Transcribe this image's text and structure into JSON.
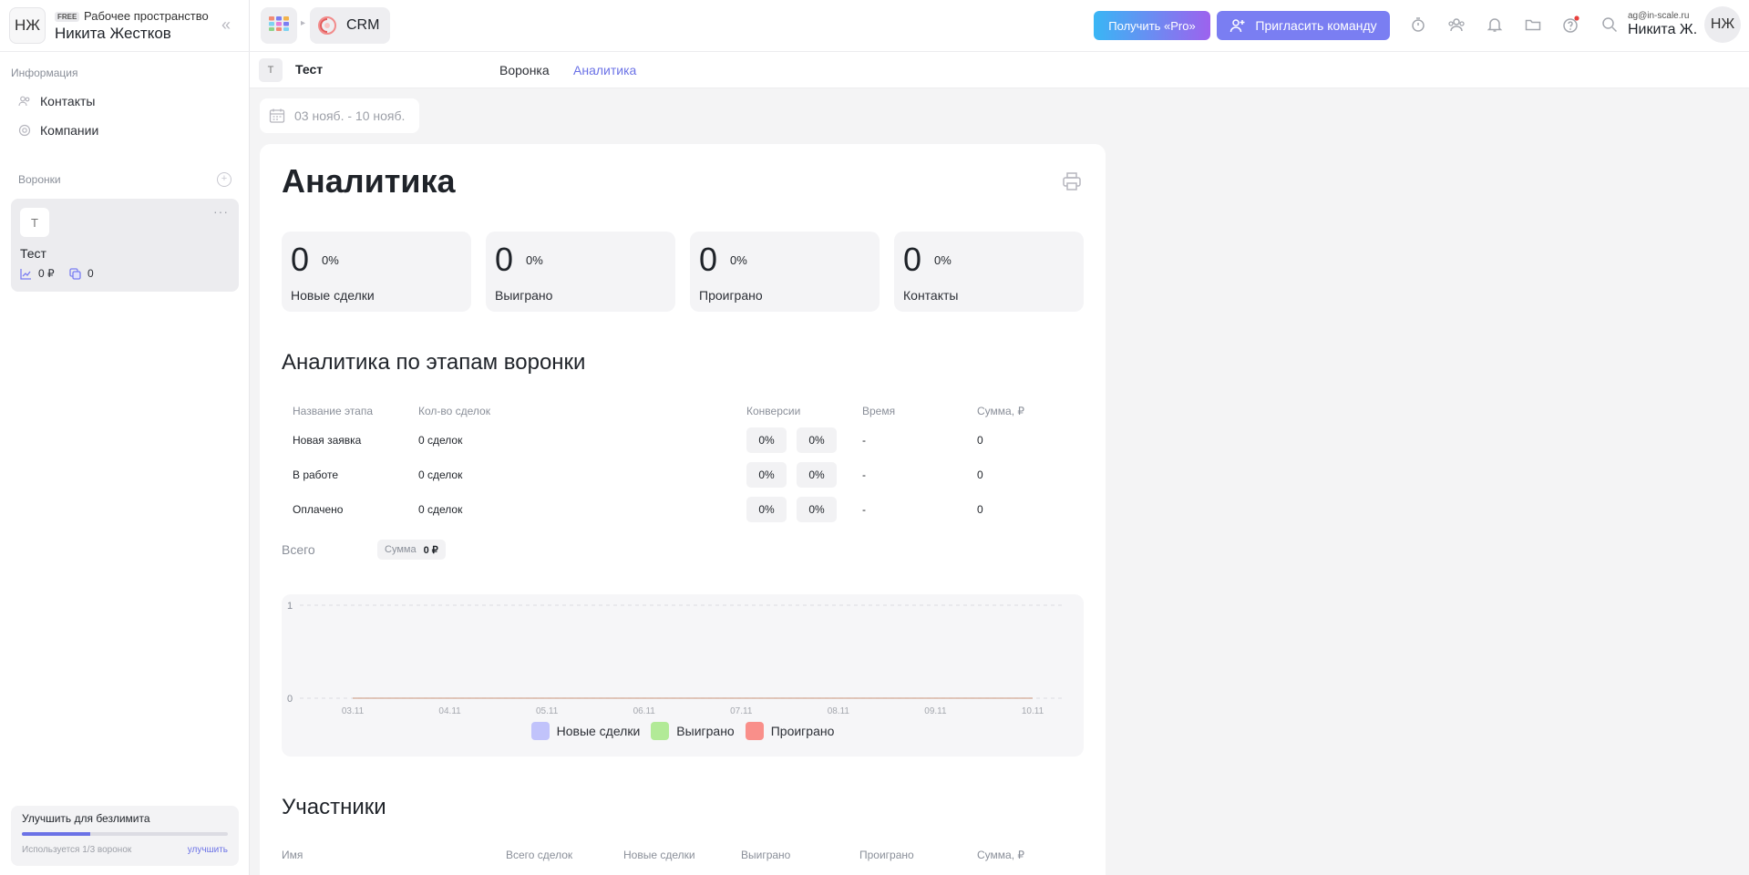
{
  "workspace": {
    "avatar": "НЖ",
    "plan_badge": "FREE",
    "label": "Рабочее пространство",
    "owner": "Никита Жестков"
  },
  "sidebar": {
    "info_title": "Информация",
    "links": [
      {
        "label": "Контакты",
        "icon": "contacts-icon"
      },
      {
        "label": "Компании",
        "icon": "companies-icon"
      }
    ],
    "funnels_title": "Воронки",
    "funnel": {
      "avatar": "Т",
      "name": "Тест",
      "amount": "0 ₽",
      "deals": "0"
    },
    "upgrade": {
      "title": "Улучшить для безлимита",
      "used": "Используется 1/3 воронок",
      "progress": 0.333,
      "link": "улучшить"
    }
  },
  "topbar": {
    "app_name": "CRM",
    "pro_button": "Получить «Pro»",
    "invite_button": "Пригласить команду",
    "user_email": "ag@in-scale.ru",
    "user_name": "Никита Ж.",
    "user_avatar": "НЖ"
  },
  "subheader": {
    "avatar": "Т",
    "title": "Тест",
    "tabs": [
      {
        "label": "Воронка",
        "active": false
      },
      {
        "label": "Аналитика",
        "active": true
      }
    ]
  },
  "date_range": "03 нояб. - 10 нояб.",
  "page": {
    "title": "Аналитика",
    "kpis": [
      {
        "value": "0",
        "percent": "0%",
        "label": "Новые сделки"
      },
      {
        "value": "0",
        "percent": "0%",
        "label": "Выиграно"
      },
      {
        "value": "0",
        "percent": "0%",
        "label": "Проиграно"
      },
      {
        "value": "0",
        "percent": "0%",
        "label": "Контакты"
      }
    ],
    "stages_title": "Аналитика по этапам воронки",
    "stage_headers": [
      "Название этапа",
      "Кол-во сделок",
      "Конверсии",
      "Время",
      "Сумма, ₽"
    ],
    "stages": [
      {
        "name": "Новая заявка",
        "deals": "0 сделок",
        "conv1": "0%",
        "conv2": "0%",
        "time": "-",
        "sum": "0"
      },
      {
        "name": "В работе",
        "deals": "0 сделок",
        "conv1": "0%",
        "conv2": "0%",
        "time": "-",
        "sum": "0"
      },
      {
        "name": "Оплачено",
        "deals": "0 сделок",
        "conv1": "0%",
        "conv2": "0%",
        "time": "-",
        "sum": "0"
      }
    ],
    "total_label": "Всего",
    "total_sum_label": "Сумма",
    "total_sum_value": "0 ₽",
    "members_title": "Участники",
    "members_headers": [
      "Имя",
      "Всего сделок",
      "Новые сделки",
      "Выиграно",
      "Проиграно",
      "Сумма, ₽"
    ]
  },
  "chart_data": {
    "type": "line",
    "categories": [
      "03.11",
      "04.11",
      "05.11",
      "06.11",
      "07.11",
      "08.11",
      "09.11",
      "10.11"
    ],
    "series": [
      {
        "name": "Новые сделки",
        "color": "#c1c3fb",
        "values": [
          0,
          0,
          0,
          0,
          0,
          0,
          0,
          0
        ]
      },
      {
        "name": "Выиграно",
        "color": "#b2ea97",
        "values": [
          0,
          0,
          0,
          0,
          0,
          0,
          0,
          0
        ]
      },
      {
        "name": "Проиграно",
        "color": "#f98f8a",
        "values": [
          0,
          0,
          0,
          0,
          0,
          0,
          0,
          0
        ]
      }
    ],
    "yticks": [
      "0",
      "1"
    ],
    "ylim": [
      0,
      1
    ],
    "legend": "bottom",
    "grid": true
  },
  "colors": {
    "accent": "#6b72e6",
    "tab_active": "#6b72e6",
    "notification_dot": "#e8413e"
  }
}
